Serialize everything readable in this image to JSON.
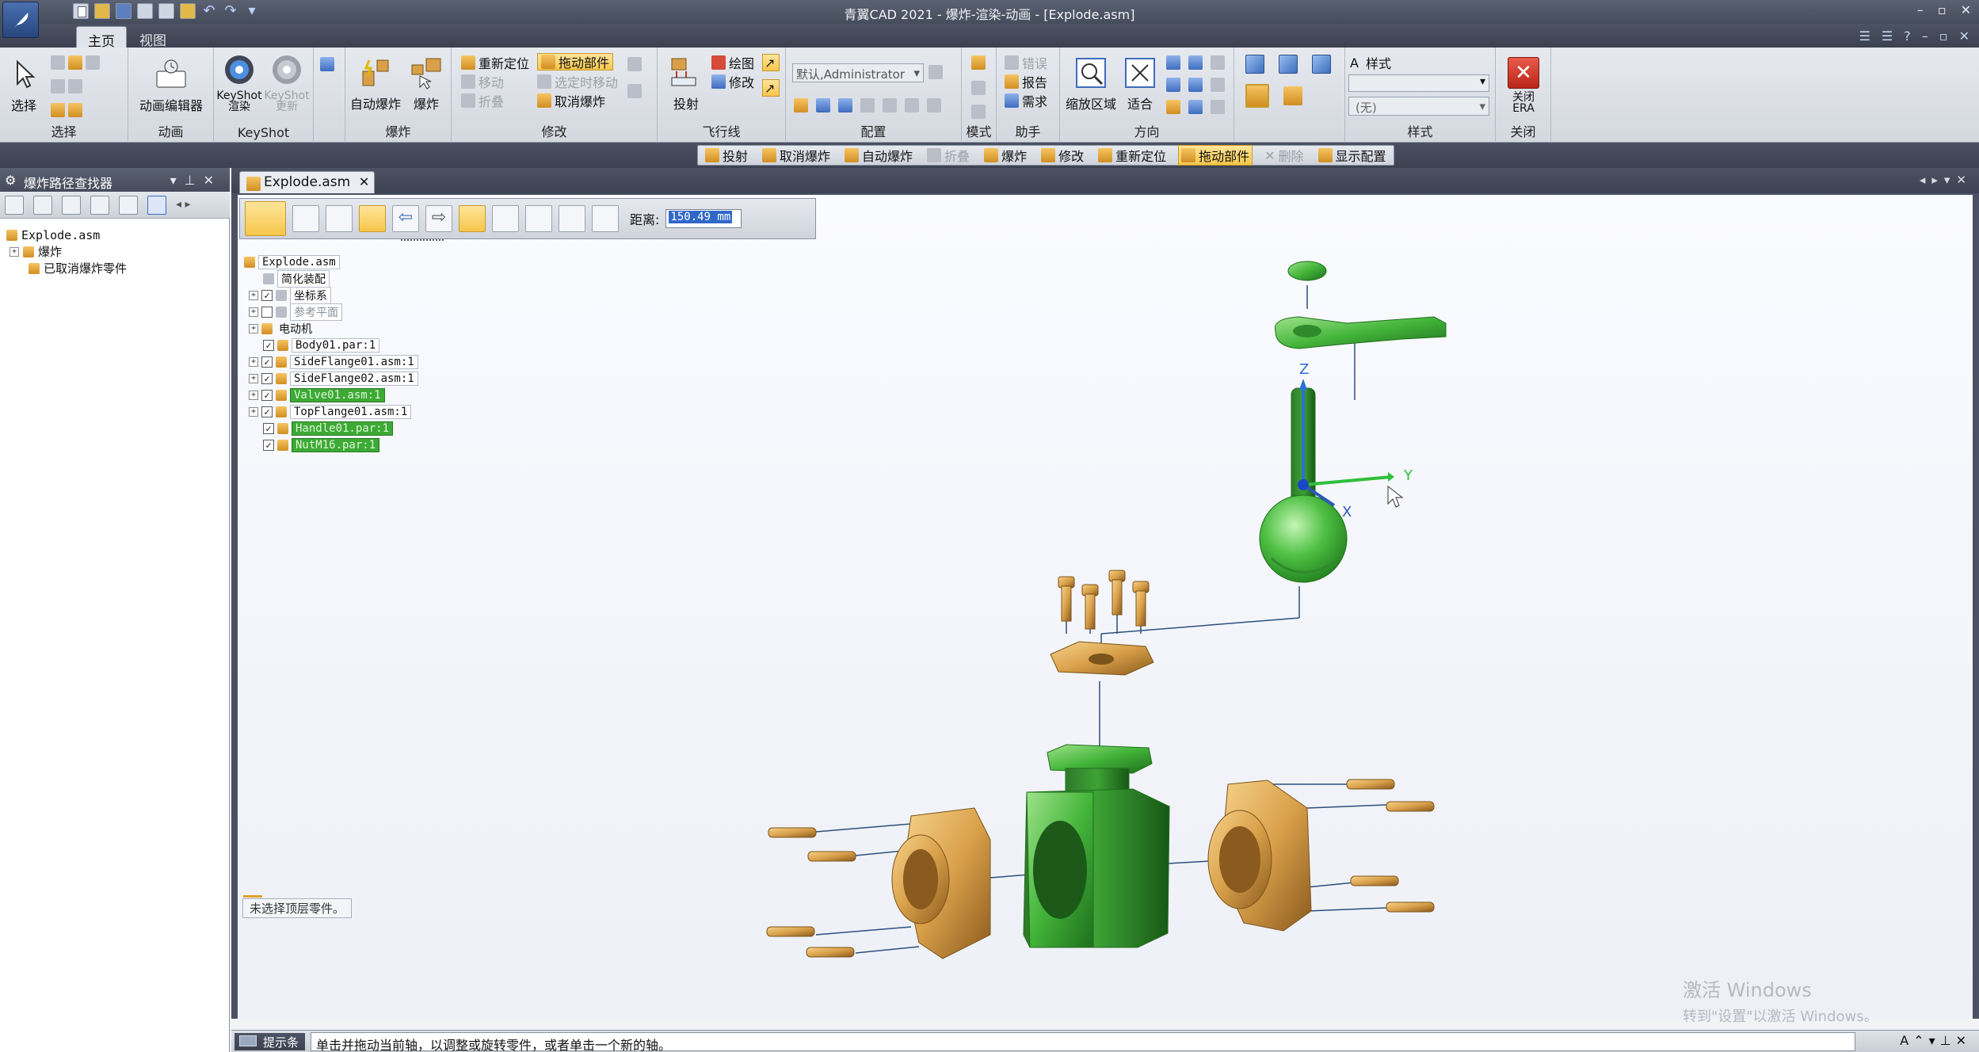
{
  "app": {
    "window_title": "青翼CAD 2021 - 爆炸-渲染-动画 - [Explode.asm]",
    "window_controls": [
      "–",
      "▫",
      "✕"
    ]
  },
  "ribbon_tabs": [
    {
      "label": "主页",
      "active": true
    },
    {
      "label": "视图",
      "active": false
    }
  ],
  "ribbon": {
    "select": {
      "button": "选择",
      "group": "选择"
    },
    "animation": {
      "button": "动画编辑器",
      "group": "动画"
    },
    "keyshot": {
      "render": "KeyShot 渲染",
      "update": "KeyShot 更新",
      "group": "KeyShot"
    },
    "explode": {
      "auto": "自动爆炸",
      "explode": "爆炸",
      "group": "爆炸"
    },
    "modify": {
      "reposition": "重新定位",
      "drag_part": "拖动部件",
      "move": "移动",
      "move_selected": "选定时移动",
      "collapse": "折叠",
      "unexplode": "取消爆炸",
      "group": "修改"
    },
    "flowline": {
      "project": "投射",
      "draw": "绘图",
      "modify": "修改",
      "group": "飞行线"
    },
    "config": {
      "value": "默认,Administrator",
      "group": "配置"
    },
    "mode": {
      "group": "模式"
    },
    "assistant": {
      "error": "错误",
      "report": "报告",
      "requirement": "需求",
      "group": "助手"
    },
    "orient": {
      "zoom_area": "缩放区域",
      "fit": "适合",
      "group": "方向"
    },
    "style": {
      "label": "样式",
      "value": "(无)",
      "group": "样式"
    },
    "close": {
      "button": "关闭 ERA",
      "group": "关闭"
    }
  },
  "command_bar": [
    {
      "label": "投射",
      "state": "normal"
    },
    {
      "label": "取消爆炸",
      "state": "normal"
    },
    {
      "label": "自动爆炸",
      "state": "normal"
    },
    {
      "label": "折叠",
      "state": "dim"
    },
    {
      "label": "爆炸",
      "state": "normal"
    },
    {
      "label": "修改",
      "state": "normal"
    },
    {
      "label": "重新定位",
      "state": "normal"
    },
    {
      "label": "拖动部件",
      "state": "active"
    },
    {
      "label": "删除",
      "state": "dim"
    },
    {
      "label": "显示配置",
      "state": "normal"
    }
  ],
  "left_panel": {
    "title": "爆炸路径查找器",
    "tree": [
      {
        "label": "Explode.asm",
        "indent": 0,
        "expander": ""
      },
      {
        "label": "爆炸",
        "indent": 1,
        "expander": "+"
      },
      {
        "label": "已取消爆炸零件",
        "indent": 1,
        "expander": ""
      }
    ]
  },
  "document": {
    "tab": "Explode.asm"
  },
  "explode_toolbar": {
    "distance_label": "距离:",
    "distance_value": "150.49 mm"
  },
  "assembly_tree": [
    {
      "label": "Explode.asm",
      "indent": 0,
      "expander": "",
      "check": "",
      "style": "normal"
    },
    {
      "label": "简化装配",
      "indent": 1,
      "expander": "",
      "check": "",
      "style": "normal"
    },
    {
      "label": "坐标系",
      "indent": 1,
      "expander": "+",
      "check": "✓",
      "style": "normal"
    },
    {
      "label": "参考平面",
      "indent": 1,
      "expander": "+",
      "check": "",
      "style": "dim"
    },
    {
      "label": "电动机",
      "indent": 1,
      "expander": "+",
      "check": "",
      "style": "normal"
    },
    {
      "label": "Body01.par:1",
      "indent": 1,
      "expander": "",
      "check": "✓",
      "style": "normal"
    },
    {
      "label": "SideFlange01.asm:1",
      "indent": 1,
      "expander": "+",
      "check": "✓",
      "style": "normal"
    },
    {
      "label": "SideFlange02.asm:1",
      "indent": 1,
      "expander": "+",
      "check": "✓",
      "style": "normal"
    },
    {
      "label": "Valve01.asm:1",
      "indent": 1,
      "expander": "+",
      "check": "✓",
      "style": "green"
    },
    {
      "label": "TopFlange01.asm:1",
      "indent": 1,
      "expander": "+",
      "check": "✓",
      "style": "normal"
    },
    {
      "label": "Handle01.par:1",
      "indent": 1,
      "expander": "",
      "check": "✓",
      "style": "green"
    },
    {
      "label": "NutM16.par:1",
      "indent": 1,
      "expander": "",
      "check": "✓",
      "style": "green"
    }
  ],
  "viewport": {
    "status_message": "未选择顶层零件。",
    "axes": {
      "z": "Z",
      "y": "Y",
      "x": "X"
    }
  },
  "watermark": {
    "line1": "激活 Windows",
    "line2": "转到\"设置\"以激活 Windows。"
  },
  "statusbar": {
    "label": "提示条",
    "text": "单击并拖动当前轴，以调整或旋转零件，或者单击一个新的轴。"
  },
  "colors": {
    "green_part": "#3fa83a",
    "gold_part": "#d9a04a",
    "highlight": "#f6c64a",
    "axis_blue": "#2c6fd6",
    "axis_green": "#2fbf3a"
  }
}
